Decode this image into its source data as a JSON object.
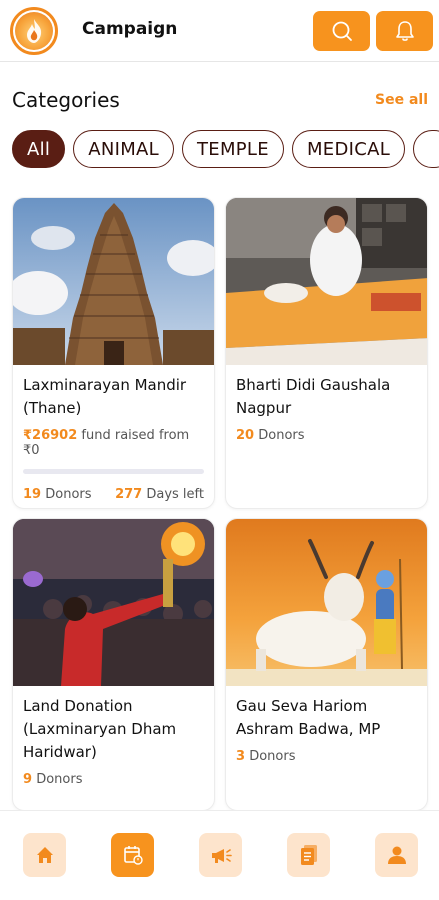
{
  "header": {
    "title": "Campaign",
    "search_icon": "search-icon",
    "bell_icon": "bell-icon",
    "accent": "#f7931e"
  },
  "categories": {
    "title": "Categories",
    "see_all": "See all",
    "chips": [
      {
        "label": "All",
        "active": true
      },
      {
        "label": "ANIMAL",
        "active": false
      },
      {
        "label": "TEMPLE",
        "active": false
      },
      {
        "label": "MEDICAL",
        "active": false
      }
    ],
    "chip_dark": "#5a1e14"
  },
  "campaigns": [
    {
      "title": "Laxminarayan Mandir (Thane)",
      "raised_amount": "₹26902",
      "raised_text": "fund raised from ₹0",
      "progress": 0,
      "donors": "19",
      "donors_label": "Donors",
      "days_left": "277",
      "days_label": "Days left"
    },
    {
      "title": "Bharti Didi Gaushala Nagpur",
      "donors": "20",
      "donors_label": "Donors"
    },
    {
      "title": "Land Donation (Laxminaryan Dham Haridwar)",
      "donors": "9",
      "donors_label": "Donors"
    },
    {
      "title": "Gau Seva Hariom Ashram Badwa, MP",
      "donors": "3",
      "donors_label": "Donors"
    }
  ],
  "bottom_nav": [
    {
      "icon": "home-icon",
      "active": false
    },
    {
      "icon": "campaign-calendar-icon",
      "active": true
    },
    {
      "icon": "megaphone-icon",
      "active": false
    },
    {
      "icon": "document-icon",
      "active": false
    },
    {
      "icon": "profile-icon",
      "active": false
    }
  ]
}
